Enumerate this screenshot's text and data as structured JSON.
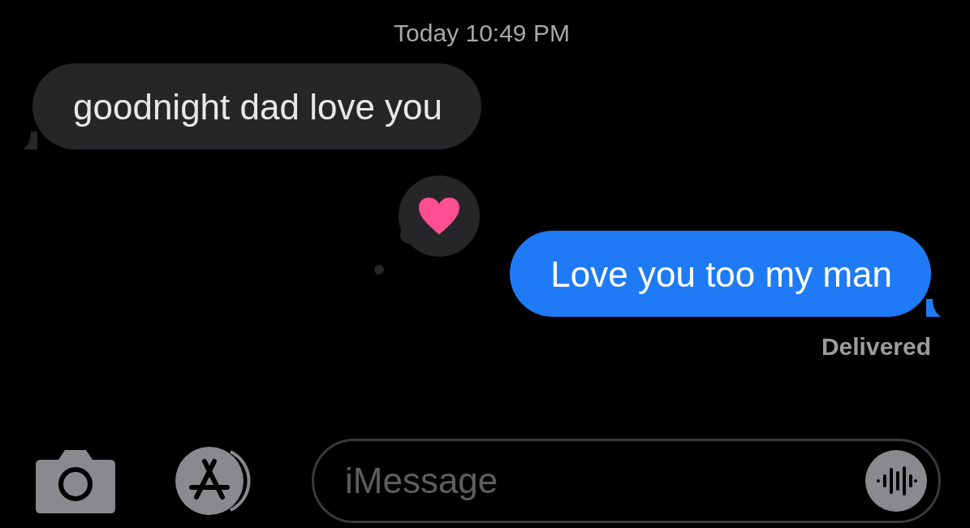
{
  "timestamp": "Today 10:49 PM",
  "messages": [
    {
      "kind": "received",
      "text": "goodnight dad love you"
    },
    {
      "kind": "sent",
      "text": "Love you too my man",
      "heart_reaction": true
    }
  ],
  "status": "Delivered",
  "composer": {
    "placeholder": "iMessage"
  }
}
